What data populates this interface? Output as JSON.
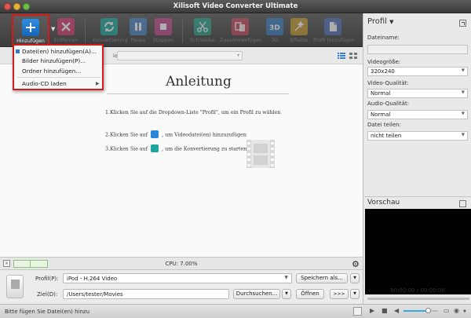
{
  "window": {
    "title": "Xilisoft Video Converter Ultimate"
  },
  "toolbar": {
    "add_label": "Hinzufügen",
    "remove_label": "Entfernen",
    "convert_label": "Konvertierung",
    "pause_label": "Pause",
    "stop_label": "Stoppen",
    "cut_label": "Schneiden",
    "merge_label": "Zusammenfügen",
    "threed_label": "3D",
    "effects_label": "Effekte",
    "addprofile_label": "Profil hinzufügen"
  },
  "add_menu": {
    "items": [
      {
        "label": "Datei(en) hinzufügen(A)..."
      },
      {
        "label": "Bilder hinzufügen(P)..."
      },
      {
        "label": "Ordner hinzufügen..."
      },
      {
        "label": "Audio-CD laden"
      }
    ]
  },
  "listbar": {
    "audio_label": "io:"
  },
  "guide": {
    "title": "Anleitung",
    "step1": "1.Klicken Sie auf die Dropdown-Liste \"Profil\", um ein Profil zu wählen",
    "step2_pre": "2.Klicken Sie auf",
    "step2_post": ", um Videodatei(en) hinzuzufügen",
    "step3_pre": "3.Klicken Sie auf",
    "step3_post": ", um die Konvertierung zu starten"
  },
  "cpu": {
    "text": "CPU: 7.00%"
  },
  "bottom": {
    "profile_label": "Profil(P):",
    "profile_value": "iPod - H.264 Video",
    "save_as": "Speichern als...",
    "dest_label": "Ziel(D):",
    "dest_value": "/Users/tester/Movies",
    "browse": "Durchsuchen...",
    "open": "Öffnen",
    "transfer": ">>>"
  },
  "status": {
    "text": "Bitte fügen Sie Datei(en) hinzu"
  },
  "panel": {
    "profile_title": "Profil",
    "filename_label": "Dateiname:",
    "filename_value": "",
    "size_label": "Videogröße:",
    "size_value": "320x240",
    "vq_label": "Video-Qualität:",
    "vq_value": "Normal",
    "aq_label": "Audio-Qualität:",
    "aq_value": "Normal",
    "split_label": "Datei teilen:",
    "split_value": "nicht teilen",
    "preview_title": "Vorschau",
    "time": "00:00:00 / 00:00:00"
  },
  "colors": {
    "accent": "#1e7fd6",
    "highlight_border": "#d21b1b"
  }
}
